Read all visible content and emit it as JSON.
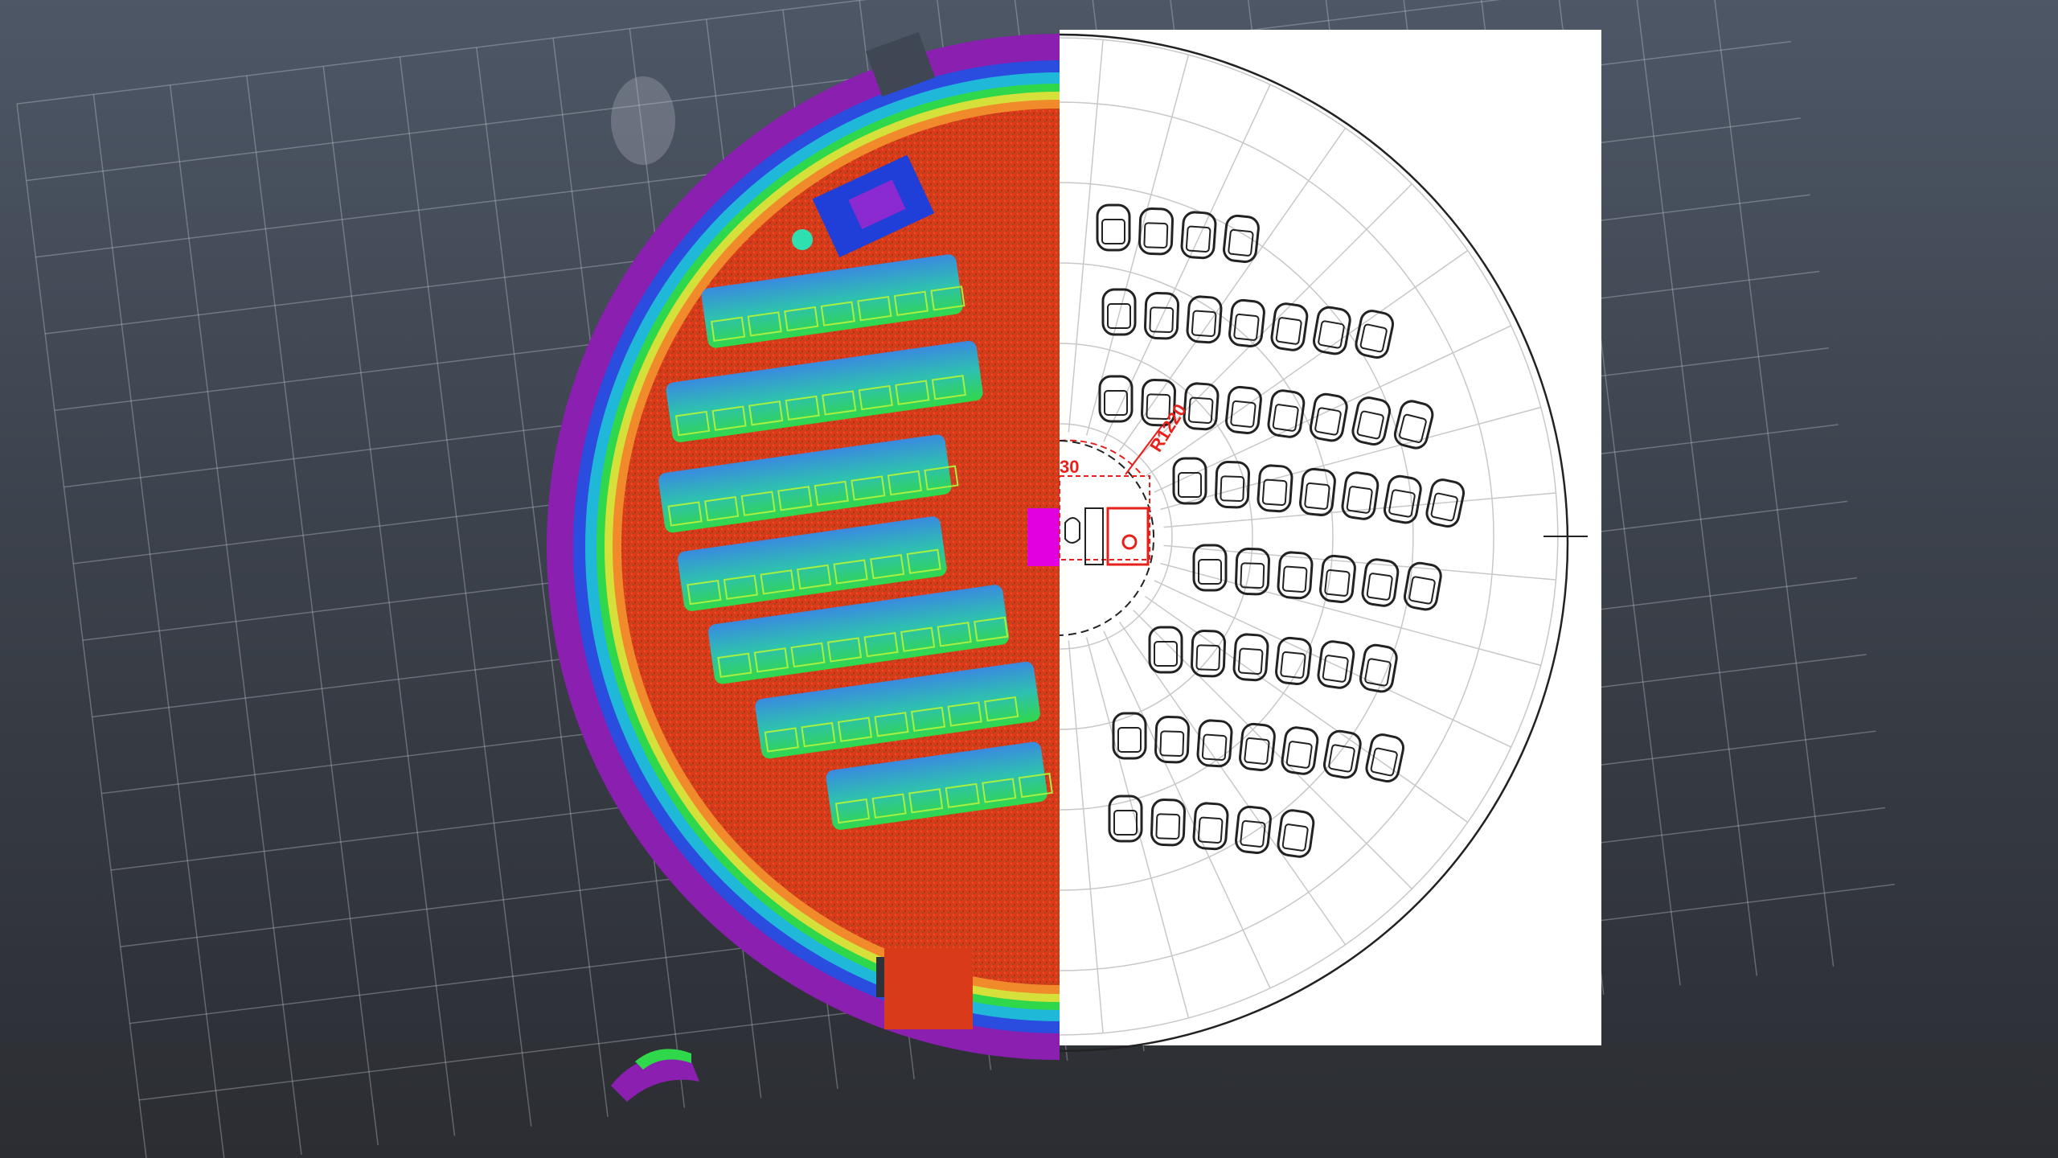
{
  "viewer": {
    "background_top": "#4d5766",
    "background_bottom": "#2b2d32",
    "grid_color": "#c9ced6"
  },
  "point_cloud": {
    "colormap": [
      "#7a1fa8",
      "#1f4be0",
      "#1ec0e0",
      "#2ed84a",
      "#d9e23a",
      "#e8431c"
    ],
    "floor_color": "#e8431c",
    "seat_rows_visible": 7
  },
  "cad_plan": {
    "background": "#ffffff",
    "line_color": "#222222",
    "grid_color": "#c8c8c8",
    "annotation_color": "#e8201c",
    "annotations": {
      "angle_label": "30",
      "radius_label": "R1220"
    },
    "seat_rows": [
      4,
      7,
      8,
      7,
      6,
      6,
      7,
      5
    ],
    "stage_marker_color": "#e000e0"
  }
}
